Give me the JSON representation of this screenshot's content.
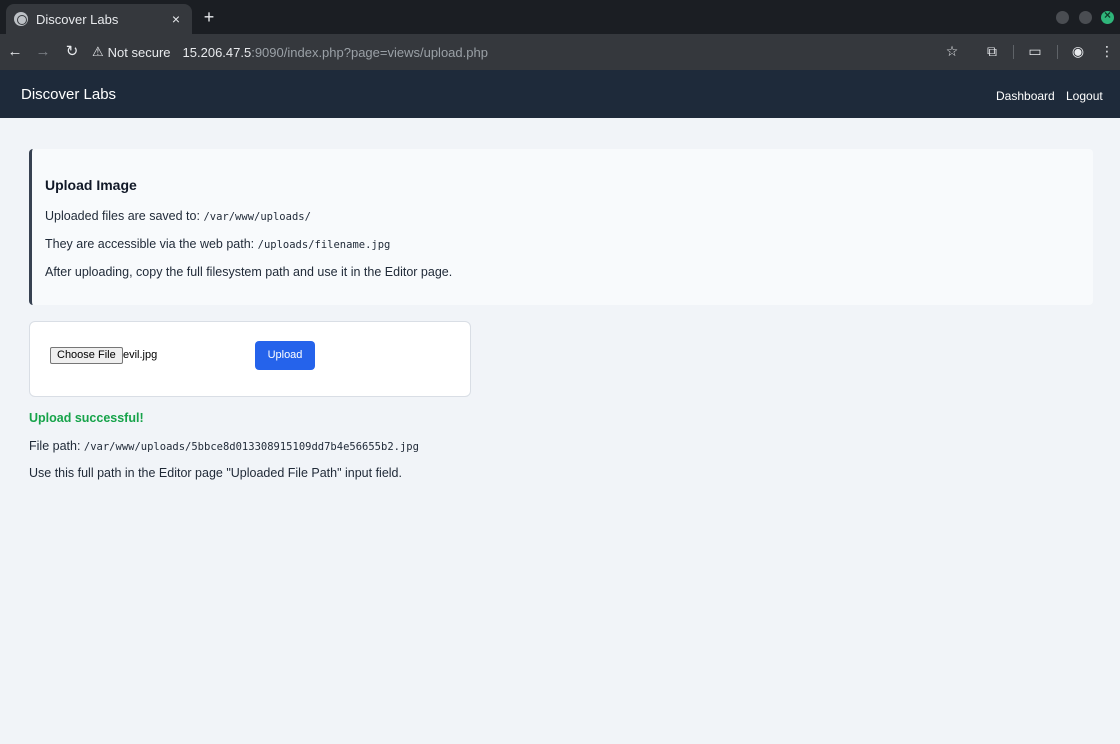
{
  "browser": {
    "tab_title": "Discover Labs",
    "tab_close": "×",
    "new_tab": "+",
    "security_label": "Not secure",
    "url_host": "15.206.47.5",
    "url_rest": ":9090/index.php?page=views/upload.php"
  },
  "navbar": {
    "brand": "Discover Labs",
    "links": [
      "Dashboard",
      "Logout"
    ]
  },
  "info": {
    "title": "Upload Image",
    "line1_text": "Uploaded files are saved to: ",
    "line1_code": "/var/www/uploads/",
    "line2_text": "They are accessible via the web path: ",
    "line2_code": "/uploads/filename.jpg",
    "line3_text": "After uploading, copy the full filesystem path and use it in the Editor page."
  },
  "form": {
    "choose_file_label": "Choose File",
    "selected_file": "evil.jpg",
    "upload_label": "Upload"
  },
  "result": {
    "status": "Upload successful!",
    "path_label": "File path: ",
    "path_value": "/var/www/uploads/5bbce8d013308915109dd7b4e56655b2.jpg",
    "instruction": "Use this full path in the Editor page \"Uploaded File Path\" input field."
  },
  "colors": {
    "navbar_bg": "#1e2a3a",
    "page_bg": "#f1f4f8",
    "primary": "#2563eb",
    "success": "#16a34a"
  }
}
